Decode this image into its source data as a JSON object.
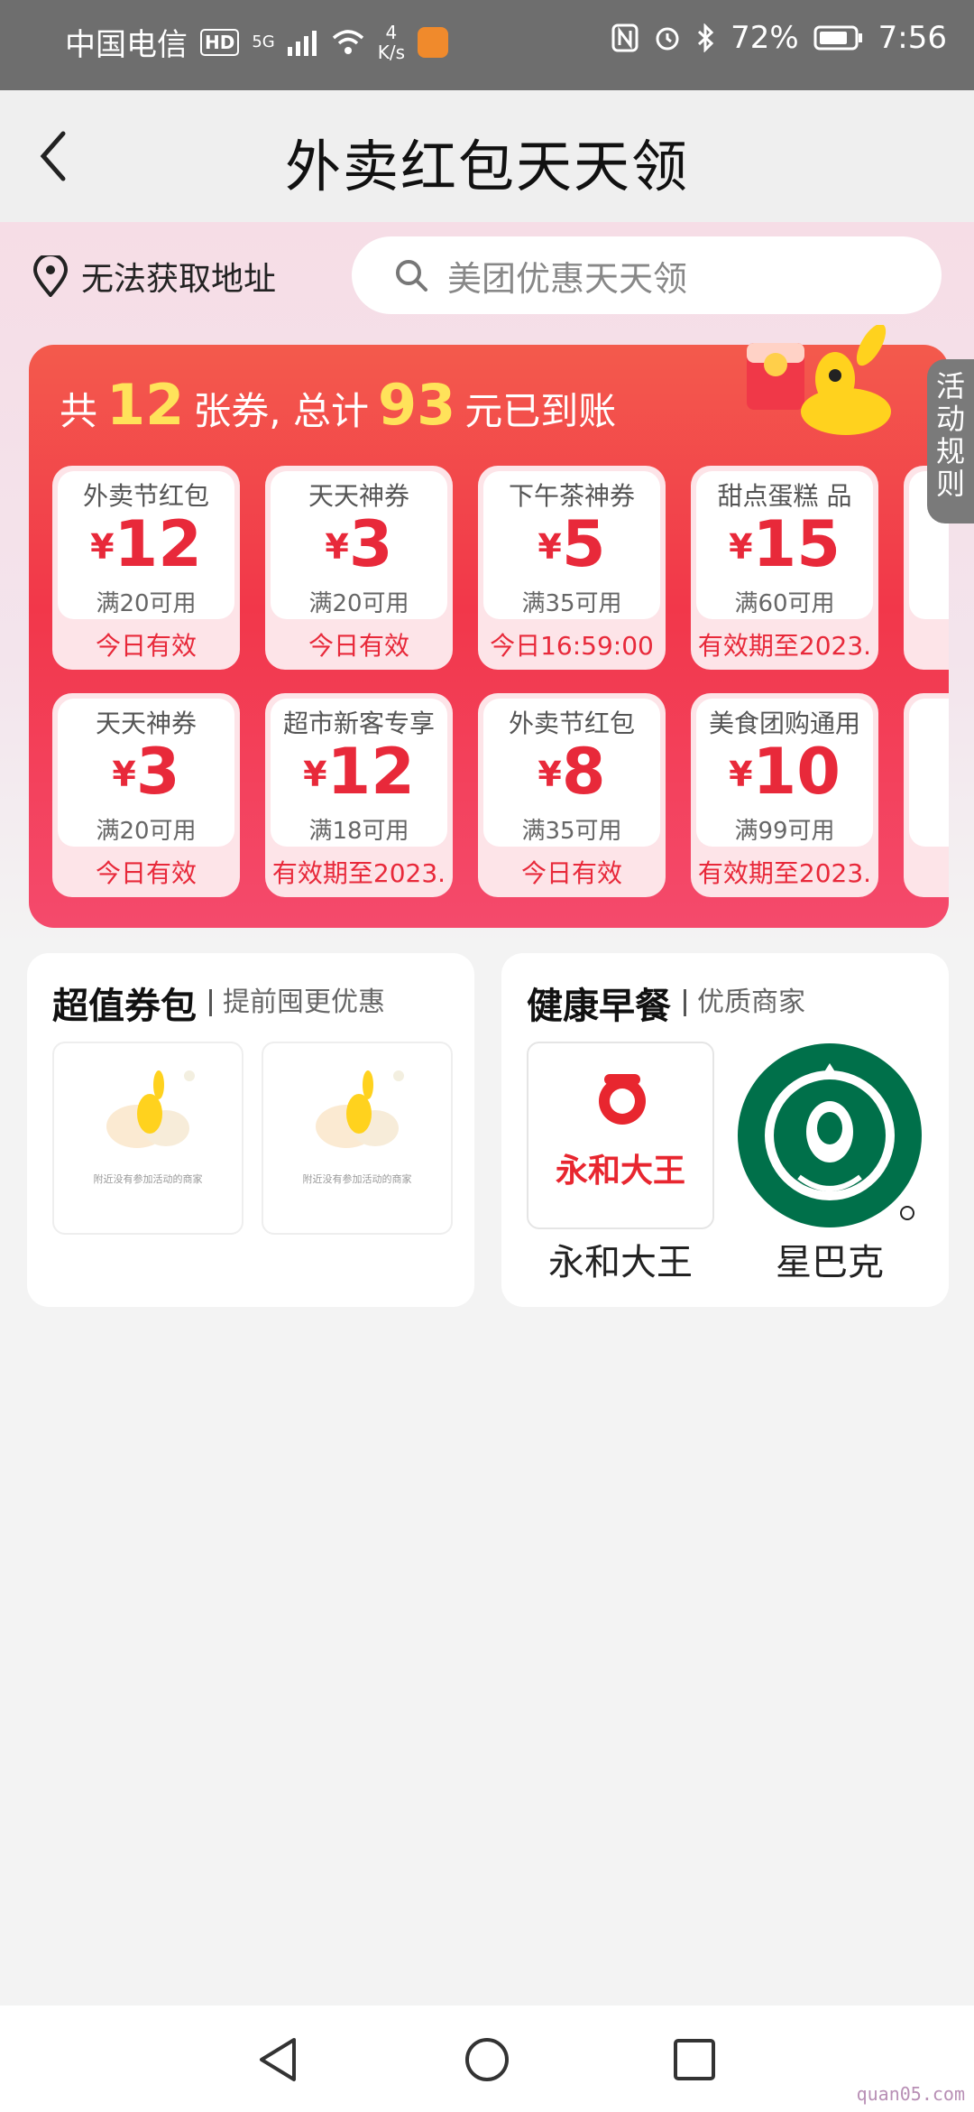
{
  "status_bar": {
    "carrier": "中国电信",
    "hd": "HD",
    "net_type": "5G",
    "speed_value": "4",
    "speed_unit": "K/s",
    "battery": "72%",
    "time": "7:56"
  },
  "header": {
    "title": "外卖红包天天领"
  },
  "location": {
    "text": "无法获取地址"
  },
  "search": {
    "placeholder": "美团优惠天天领"
  },
  "summary": {
    "prefix": "共",
    "count": "12",
    "mid": "张券, 总计",
    "total": "93",
    "suffix": "元已到账"
  },
  "currency": "¥",
  "coupons_row1": [
    {
      "name": "外卖节红包",
      "amount": "12",
      "condition": "满20可用",
      "validity": "今日有效"
    },
    {
      "name": "天天神券",
      "amount": "3",
      "condition": "满20可用",
      "validity": "今日有效"
    },
    {
      "name": "下午茶神券",
      "amount": "5",
      "condition": "满35可用",
      "validity": "今日16:59:00"
    },
    {
      "name": "甜点蛋糕 品",
      "amount": "15",
      "condition": "满60可用",
      "validity": "有效期至2023."
    }
  ],
  "coupons_row2": [
    {
      "name": "天天神券",
      "amount": "3",
      "condition": "满20可用",
      "validity": "今日有效"
    },
    {
      "name": "超市新客专享",
      "amount": "12",
      "condition": "满18可用",
      "validity": "有效期至2023."
    },
    {
      "name": "外卖节红包",
      "amount": "8",
      "condition": "满35可用",
      "validity": "今日有效"
    },
    {
      "name": "美食团购通用",
      "amount": "10",
      "condition": "满99可用",
      "validity": "有效期至2023."
    }
  ],
  "rules_tab": {
    "label": "活动规则"
  },
  "voucher_pack": {
    "title": "超值券包",
    "subtitle": "提前囤更优惠",
    "thumbs": [
      "附近没有参加活动的商家",
      "附近没有参加活动的商家"
    ]
  },
  "breakfast": {
    "title": "健康早餐",
    "subtitle": "优质商家",
    "brands": [
      {
        "name": "永和大王",
        "logo_text": "永和大王"
      },
      {
        "name": "星巴克"
      }
    ]
  },
  "watermark": "quan05.com",
  "colors": {
    "accent": "#f2374a",
    "gold": "#ffe25a",
    "starbucks_green": "#00704a"
  },
  "icons": [
    "location-pin-icon",
    "search-icon",
    "back-icon",
    "nav-back-icon",
    "nav-home-icon",
    "nav-recent-icon"
  ]
}
